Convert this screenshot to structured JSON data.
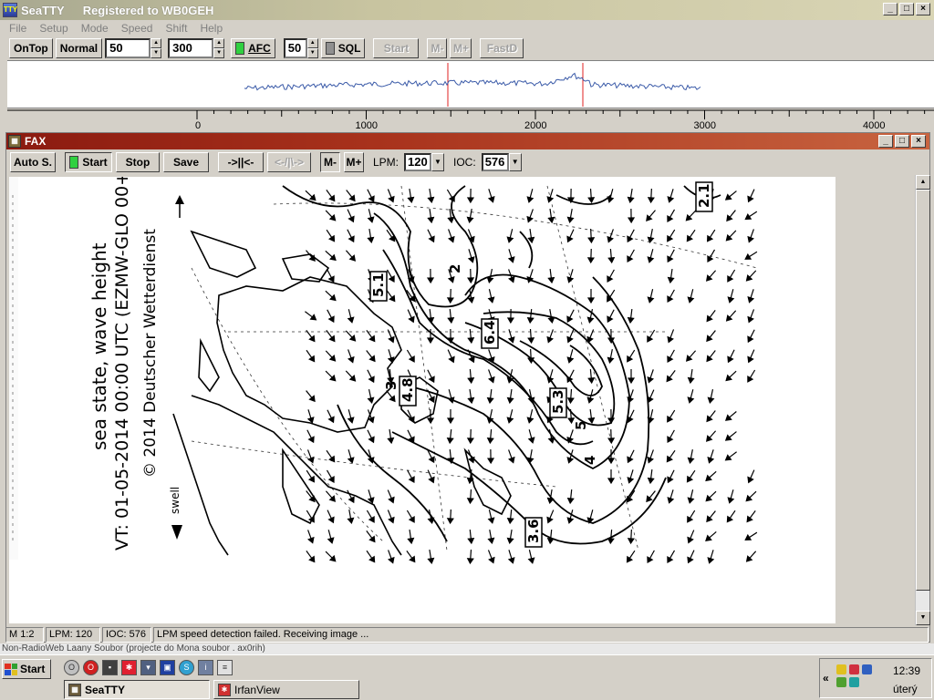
{
  "window": {
    "app_name": "SeaTTY",
    "registration": "Registered to WB0GEH",
    "minimize_glyph": "_",
    "maximize_glyph": "□",
    "close_glyph": "×"
  },
  "menu": [
    "File",
    "Setup",
    "Mode",
    "Speed",
    "Shift",
    "Help"
  ],
  "toolbar": {
    "ontop_label": "OnTop",
    "normal_label": "Normal",
    "spin1_value": "50",
    "spin2_value": "300",
    "afc_label": "AFC",
    "spin3_value": "50",
    "sql_label": "SQL",
    "start_label": "Start",
    "mminus_label": "M-",
    "mplus_label": "M+",
    "fastd_label": "FastD"
  },
  "scale": {
    "ticks": [
      "0",
      "1000",
      "2000",
      "3000",
      "4000"
    ]
  },
  "fax": {
    "title": "FAX",
    "autos_label": "Auto S.",
    "start_label": "Start",
    "stop_label": "Stop",
    "save_label": "Save",
    "align_right_label": "->||<-",
    "align_left_label": "<-/|\\->",
    "mminus_label": "M-",
    "mplus_label": "M+",
    "lpm_label": "LPM:",
    "lpm_value": "120",
    "ioc_label": "IOC:",
    "ioc_value": "576"
  },
  "chart_image": {
    "caption_line1": "sea state, wave height",
    "caption_line2": "VT: 01-05-2014 00:00 UTC (EZMW-GLO 00+",
    "caption_line3": "© 2014 Deutscher Wetterdienst",
    "swell_label": "swell",
    "contour_labels": [
      "5.1",
      "6.4",
      "4.8",
      "5.3",
      "3.6",
      "2.1",
      "2",
      "3",
      "4",
      "5"
    ]
  },
  "statusbar": {
    "zoom": "M 1:2",
    "lpm": "LPM: 120",
    "ioc": "IOC: 576",
    "message": "LPM speed detection failed. Receiving image ..."
  },
  "taskbar": {
    "start_label": "Start",
    "strip_text": "Non-RadioWeb Laany Soubor (projecte do Mona soubor . ax0rih)",
    "tasks": [
      {
        "label": "SeaTTY",
        "active": true
      },
      {
        "label": "IrfanView",
        "active": false
      }
    ],
    "clock": "12:39",
    "day": "úterý"
  },
  "colors": {
    "titlebar_main": "#c8c4a0",
    "titlebar_fax": "#a8321c",
    "spectrum_trace": "#3a5aa8",
    "marker_red": "#e02020"
  }
}
